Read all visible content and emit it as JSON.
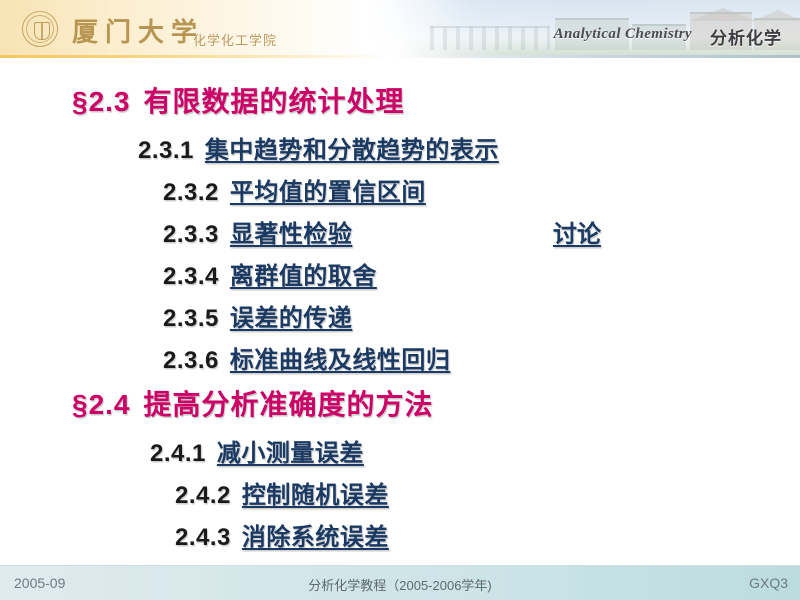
{
  "header": {
    "seal_icon": "university-seal-icon",
    "university_name": "厦门大学",
    "college_name": "化学化工学院",
    "course_title_en": "Analytical Chemistry",
    "course_title_cn": "分析化学"
  },
  "slide": {
    "sections": [
      {
        "marker": "§2.3",
        "title": "有限数据的统计处理",
        "items": [
          {
            "num": "2.3.1",
            "label": "集中趋势和分散趋势的表示",
            "tail": ""
          },
          {
            "num": "2.3.2",
            "label": "平均值的置信区间",
            "tail": ""
          },
          {
            "num": "2.3.3",
            "label": "显著性检验",
            "tail": "讨论"
          },
          {
            "num": "2.3.4",
            "label": "离群值的取舍",
            "tail": ""
          },
          {
            "num": "2.3.5",
            "label": "误差的传递",
            "tail": ""
          },
          {
            "num": "2.3.6",
            "label": "标准曲线及线性回归",
            "tail": ""
          }
        ]
      },
      {
        "marker": "§2.4",
        "title": "提高分析准确度的方法",
        "items": [
          {
            "num": "2.4.1",
            "label": "减小测量误差",
            "tail": ""
          },
          {
            "num": "2.4.2",
            "label": "控制随机误差",
            "tail": ""
          },
          {
            "num": "2.4.3",
            "label": "消除系统误差",
            "tail": ""
          }
        ]
      }
    ]
  },
  "footer": {
    "date": "2005-09",
    "course": "分析化学教程（2005-2006学年)",
    "code": "GXQ3"
  },
  "colors": {
    "section_marker": "#cc0066",
    "link_text": "#1a3a63",
    "number_text": "#1a1a1a",
    "header_left_bg": "#f7e3b4",
    "footer_bg": "#cde4e7"
  }
}
